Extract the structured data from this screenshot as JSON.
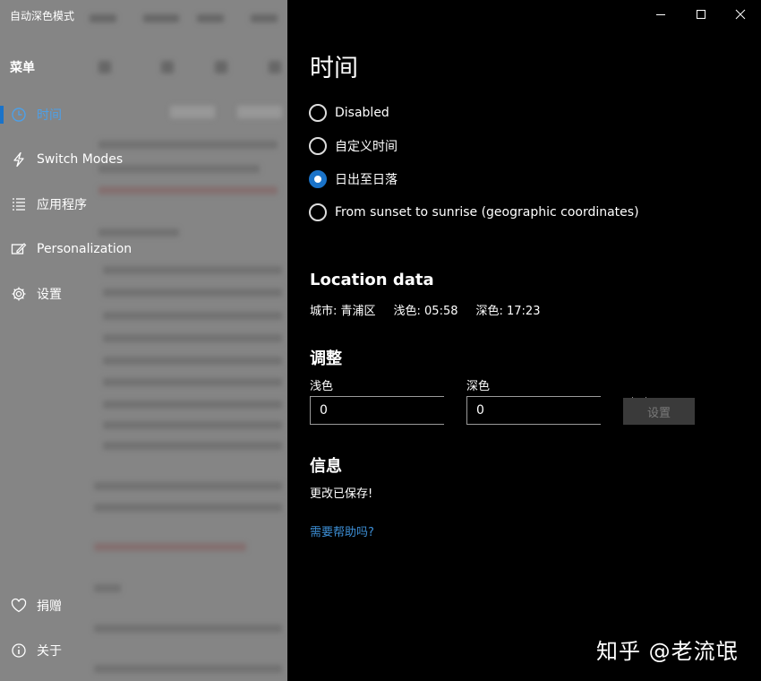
{
  "window": {
    "title": "自动深色模式",
    "controls": [
      "minimize-icon",
      "maximize-icon",
      "close-icon"
    ]
  },
  "sidebar": {
    "menu_title": "菜单",
    "items": [
      {
        "label": "时间",
        "icon": "clock-icon",
        "selected": true
      },
      {
        "label": "Switch Modes",
        "icon": "lightning-icon",
        "selected": false
      },
      {
        "label": "应用程序",
        "icon": "list-icon",
        "selected": false
      },
      {
        "label": "Personalization",
        "icon": "pen-screen-icon",
        "selected": false
      },
      {
        "label": "设置",
        "icon": "gear-icon",
        "selected": false
      }
    ],
    "bottom_items": [
      {
        "label": "捐赠",
        "icon": "heart-icon"
      },
      {
        "label": "关于",
        "icon": "info-icon"
      }
    ]
  },
  "main": {
    "title": "时间",
    "options": [
      {
        "label": "Disabled",
        "checked": false
      },
      {
        "label": "自定义时间",
        "checked": false
      },
      {
        "label": "日出至日落",
        "checked": true
      },
      {
        "label": "From sunset to sunrise (geographic coordinates)",
        "checked": false
      }
    ],
    "location": {
      "heading": "Location data",
      "city": "城市: 青浦区",
      "light": "浅色: 05:58",
      "dark": "深色: 17:23"
    },
    "adjust": {
      "heading": "调整",
      "light_label": "浅色",
      "light_value": "0",
      "dark_label": "深色",
      "dark_value": "0",
      "set_label": "设置"
    },
    "info": {
      "heading": "信息",
      "text": "更改已保存!"
    },
    "help_link": "需要帮助吗?"
  },
  "watermark": "知乎 @老流氓",
  "colors": {
    "accent": "#1a73c9",
    "link": "#3d8fd6",
    "background": "#000000",
    "sidebar": "#8c8c8c"
  }
}
